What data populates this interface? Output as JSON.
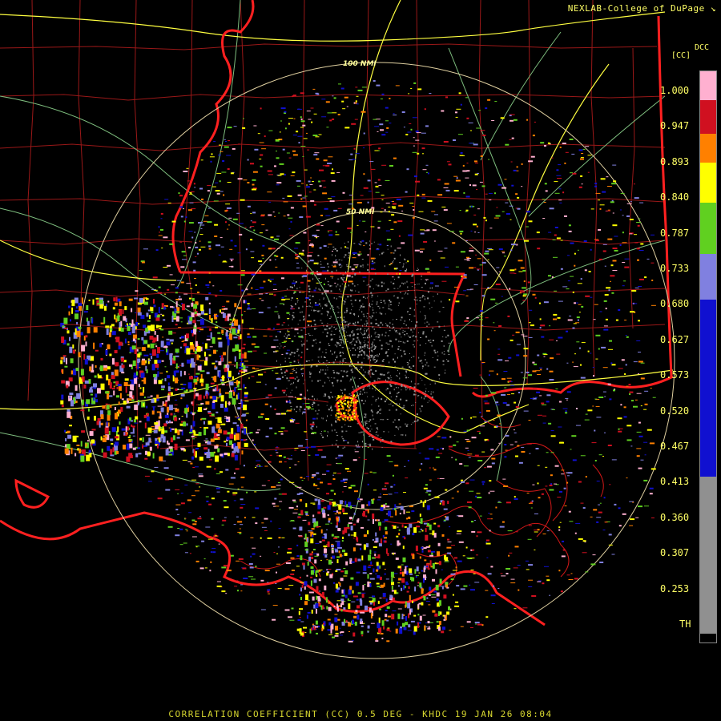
{
  "credit": "NEXLAB-College of DuPage",
  "footer": "CORRELATION COEFFICIENT (CC) 0.5 DEG - KHDC 19 JAN 26 08:04",
  "colorbar": {
    "title": "DCC",
    "unit": "[CC]",
    "labels": [
      "1.000",
      "0.947",
      "0.893",
      "0.840",
      "0.787",
      "0.733",
      "0.680",
      "0.627",
      "0.573",
      "0.520",
      "0.467",
      "0.413",
      "0.360",
      "0.307",
      "0.253",
      "TH"
    ],
    "colors": {
      "pink": "#ffb0d0",
      "red": "#d01020",
      "orange": "#ff8000",
      "yellow": "#ffff00",
      "green": "#60d020",
      "lavender": "#8080e0",
      "blue": "#1010d0",
      "gray": "#909090"
    }
  },
  "range_rings": [
    "100 NMI",
    "50 NMI"
  ],
  "colors": {
    "state_lines": "#ff2020",
    "county_lines": "#a01818",
    "highways": "#ffff40",
    "roads": "#80c080",
    "rings": "#e0d0a0",
    "background": "#000000"
  },
  "icons": {
    "credit_mark": "corner-arrow-icon"
  }
}
